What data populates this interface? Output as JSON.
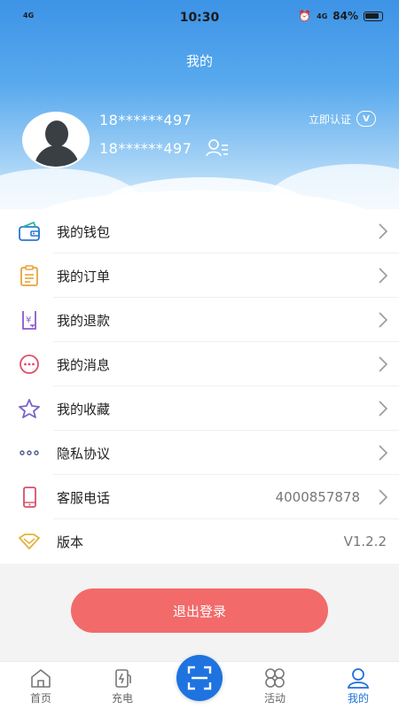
{
  "status_bar": {
    "network": "4G",
    "time": "10:30",
    "right_network": "4G",
    "battery": "84%"
  },
  "nav": {
    "title": "我的"
  },
  "profile": {
    "phone_primary": "18******497",
    "phone_secondary": "18******497",
    "verify_label": "立即认证",
    "verify_badge": "V"
  },
  "menu": {
    "items": [
      {
        "label": "我的钱包",
        "icon": "wallet-icon",
        "value": ""
      },
      {
        "label": "我的订单",
        "icon": "clipboard-icon",
        "value": ""
      },
      {
        "label": "我的退款",
        "icon": "refund-icon",
        "value": ""
      },
      {
        "label": "我的消息",
        "icon": "message-icon",
        "value": ""
      },
      {
        "label": "我的收藏",
        "icon": "star-icon",
        "value": ""
      },
      {
        "label": "隐私协议",
        "icon": "dots-icon",
        "value": ""
      },
      {
        "label": "客服电话",
        "icon": "phone-icon",
        "value": "4000857878"
      },
      {
        "label": "版本",
        "icon": "diamond-icon",
        "value": "V1.2.2"
      }
    ]
  },
  "logout": {
    "label": "退出登录"
  },
  "tabbar": {
    "tabs": [
      {
        "label": "首页",
        "icon": "home-icon"
      },
      {
        "label": "充电",
        "icon": "charge-icon"
      },
      {
        "label": "",
        "icon": "scan-icon"
      },
      {
        "label": "活动",
        "icon": "activity-icon"
      },
      {
        "label": "我的",
        "icon": "profile-icon"
      }
    ],
    "active_color": "#1e6fd9"
  },
  "colors": {
    "header_top": "#3d93e6",
    "logout": "#f26a6a",
    "accent": "#1e73e0"
  }
}
